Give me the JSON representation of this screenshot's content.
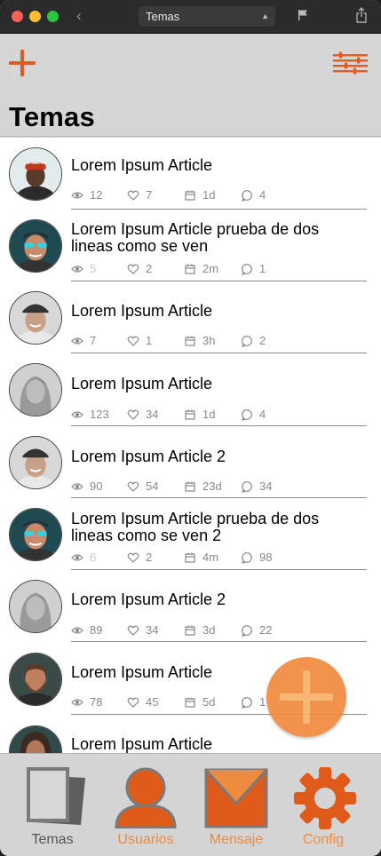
{
  "window": {
    "title": "Temas"
  },
  "header": {
    "title": "Temas"
  },
  "rows": [
    {
      "title": "Lorem Ipsum Article",
      "views": "12",
      "likes": "7",
      "date": "1d",
      "comments": "4",
      "avatar": "man-dark-beanie",
      "dim_views": false
    },
    {
      "title": "Lorem Ipsum Article prueba de dos lineas como se ven",
      "views": "5",
      "likes": "2",
      "date": "2m",
      "comments": "1",
      "avatar": "man-sunglasses",
      "dim_views": true
    },
    {
      "title": "Lorem Ipsum Article",
      "views": "7",
      "likes": "1",
      "date": "3h",
      "comments": "2",
      "avatar": "man-cap",
      "dim_views": false
    },
    {
      "title": "Lorem Ipsum Article",
      "views": "123",
      "likes": "34",
      "date": "1d",
      "comments": "4",
      "avatar": "woman-blonde",
      "dim_views": false
    },
    {
      "title": "Lorem Ipsum Article 2",
      "views": "90",
      "likes": "54",
      "date": "23d",
      "comments": "34",
      "avatar": "man-cap",
      "dim_views": false
    },
    {
      "title": "Lorem Ipsum Article prueba de dos lineas como se ven 2",
      "views": "6",
      "likes": "2",
      "date": "4m",
      "comments": "98",
      "avatar": "man-sunglasses",
      "dim_views": true
    },
    {
      "title": "Lorem Ipsum Article 2",
      "views": "89",
      "likes": "34",
      "date": "3d",
      "comments": "22",
      "avatar": "woman-blonde",
      "dim_views": false
    },
    {
      "title": "Lorem Ipsum Article",
      "views": "78",
      "likes": "45",
      "date": "5d",
      "comments": "1",
      "avatar": "man-beard",
      "dim_views": false
    },
    {
      "title": "Lorem Ipsum Article",
      "views": "",
      "likes": "",
      "date": "",
      "comments": "",
      "avatar": "woman-curly",
      "dim_views": false
    }
  ],
  "tabs": [
    {
      "label": "Temas",
      "icon": "documents-icon",
      "active": true
    },
    {
      "label": "Usuarios",
      "icon": "user-icon",
      "active": false
    },
    {
      "label": "Mensaje",
      "icon": "envelope-icon",
      "active": false
    },
    {
      "label": "Config",
      "icon": "gear-icon",
      "active": false
    }
  ],
  "colors": {
    "accent": "#e05a26",
    "inactive_tab": "#f08a3e",
    "active_tab": "#555555",
    "fab": "#f08a3e"
  }
}
